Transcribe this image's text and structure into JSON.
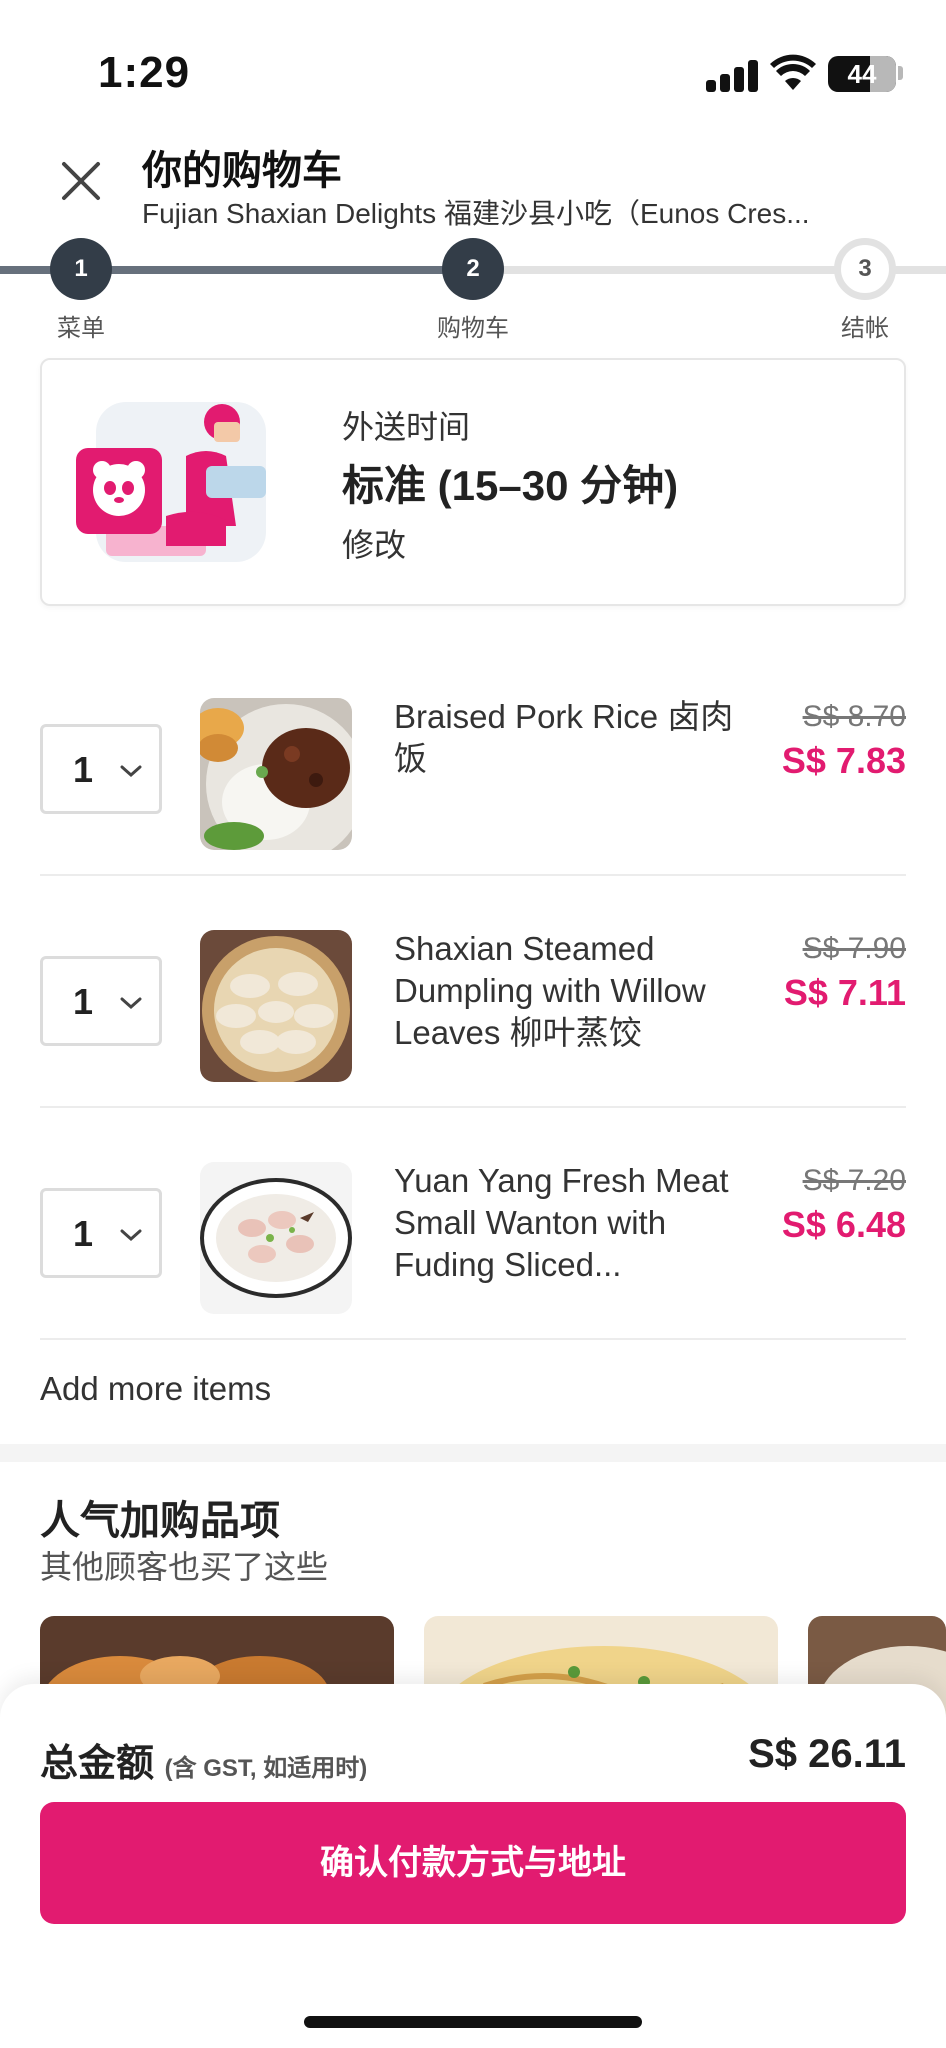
{
  "status_bar": {
    "time": "1:29",
    "battery": "44"
  },
  "header": {
    "title": "你的购物车",
    "subtitle": "Fujian Shaxian Delights 福建沙县小吃（Eunos Cres..."
  },
  "stepper": {
    "steps": [
      {
        "number": "1",
        "label": "菜单"
      },
      {
        "number": "2",
        "label": "购物车"
      },
      {
        "number": "3",
        "label": "结帐"
      }
    ],
    "current_step": 2
  },
  "delivery": {
    "label": "外送时间",
    "value": "标准 (15–30 分钟)",
    "edit_label": "修改"
  },
  "cart": {
    "items": [
      {
        "qty": "1",
        "name": "Braised Pork Rice 卤肉饭",
        "price_old": "S$ 8.70",
        "price_new": "S$ 7.83"
      },
      {
        "qty": "1",
        "name": "Shaxian Steamed Dumpling with Willow Leaves 柳叶蒸饺",
        "price_old": "S$ 7.90",
        "price_new": "S$ 7.11"
      },
      {
        "qty": "1",
        "name": "Yuan Yang Fresh Meat Small Wanton with Fuding Sliced...",
        "price_old": "S$ 7.20",
        "price_new": "S$ 6.48"
      }
    ],
    "add_more": "Add more items"
  },
  "popular": {
    "title": "人气加购品项",
    "subtitle": "其他顾客也买了这些"
  },
  "footer": {
    "total_label": "总金额",
    "total_note": "(含 GST, 如适用时)",
    "total_value": "S$ 26.11",
    "cta": "确认付款方式与地址"
  },
  "colors": {
    "brand_pink": "#e21b70",
    "stepper_dark": "#333d48"
  }
}
